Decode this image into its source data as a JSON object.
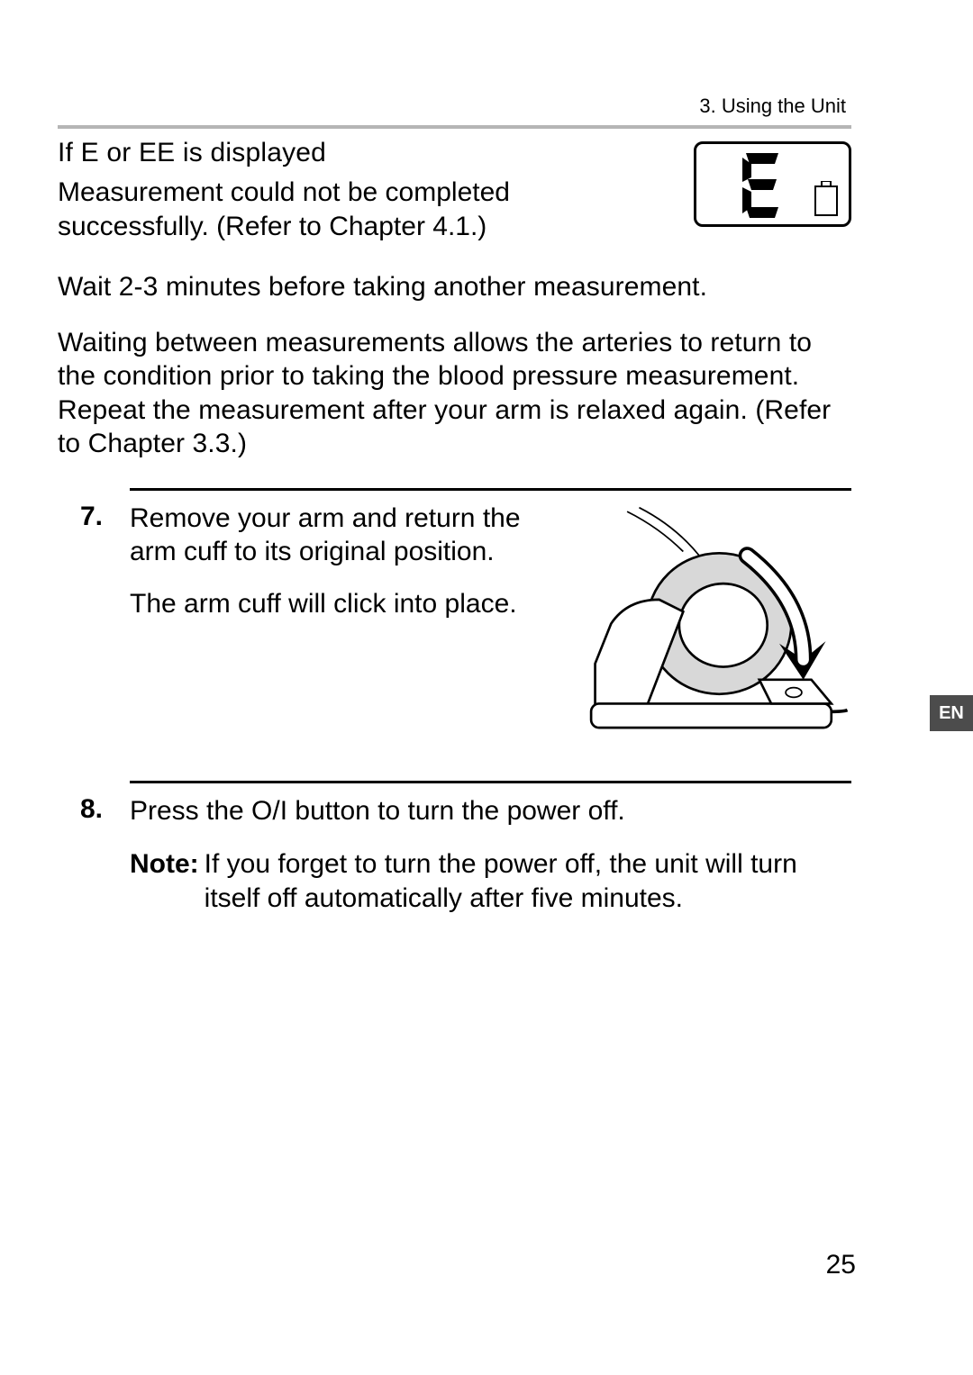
{
  "section_header": "3. Using the Unit",
  "error_block": {
    "title": "If  E  or  EE  is displayed",
    "body": "Measurement could not be completed successfully. (Refer to Chapter 4.1.)"
  },
  "wait_para": "Wait 2-3 minutes before taking another measurement.",
  "explain_para": "Waiting between measurements allows the arteries to return to the condition prior to taking the blood pressure measurement. Repeat the measurement after your arm is relaxed again. (Refer to Chapter 3.3.)",
  "step7": {
    "num": "7.",
    "line1": "Remove your arm and return the arm cuff to its original position.",
    "line2": "The arm cuff will click into place."
  },
  "step8": {
    "num": "8.",
    "line1": "Press the O/I button to turn the power off.",
    "note_label": "Note:",
    "note_body": "If you forget to turn the power off, the unit will turn itself off automatically after five minutes."
  },
  "lang_tab": "EN",
  "page_number": "25",
  "icons": {
    "lcd": "lcd-error-display",
    "device": "device-cuff-return"
  }
}
